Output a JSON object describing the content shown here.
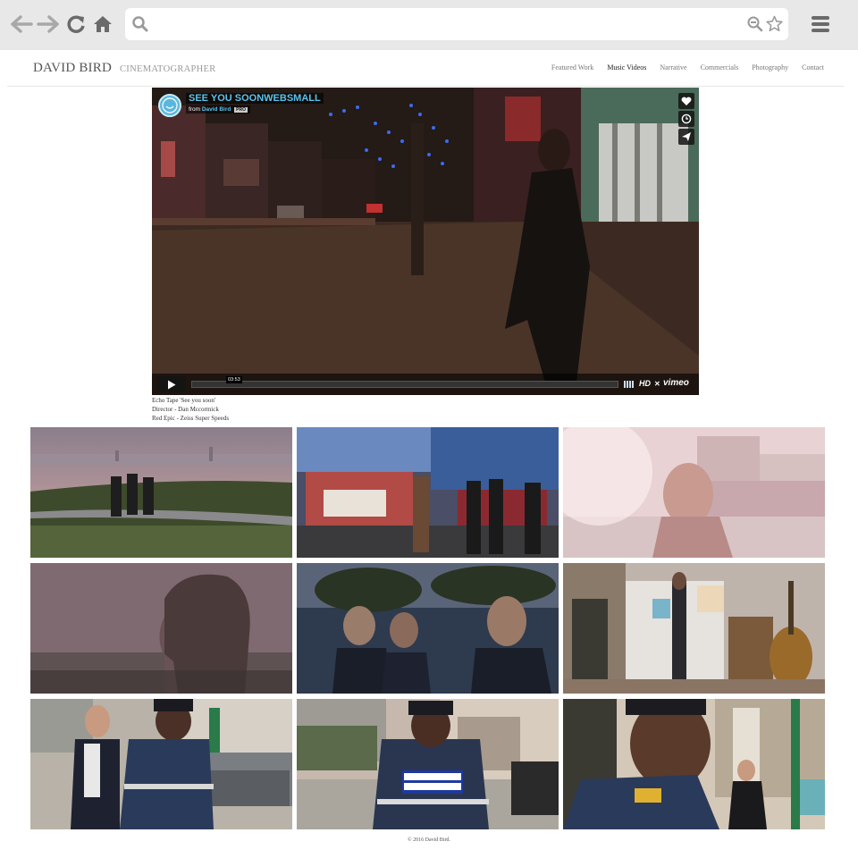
{
  "browser": {
    "url_value": "",
    "icons": [
      "back-arrow-icon",
      "forward-arrow-icon",
      "reload-icon",
      "home-icon",
      "search-icon",
      "zoom-out-icon",
      "star-icon",
      "menu-icon"
    ]
  },
  "site": {
    "brand": "DAVID BIRD",
    "tagline": "CINEMATOGRAPHER",
    "nav": [
      {
        "label": "Featured Work",
        "active": false
      },
      {
        "label": "Music Videos",
        "active": true
      },
      {
        "label": "Narrative",
        "active": false
      },
      {
        "label": "Commercials",
        "active": false
      },
      {
        "label": "Photography",
        "active": false
      },
      {
        "label": "Contact",
        "active": false
      }
    ]
  },
  "video": {
    "title": "SEE YOU SOONWEBSMALL",
    "from_prefix": "from",
    "author": "David Bird",
    "badge": "PRO",
    "time": "03:53",
    "hd_label": "HD",
    "brand_label": "vimeo",
    "accent_color": "#59c3ec"
  },
  "credits": [
    "Echo Tape 'See you soon'",
    "Director - Dan Mccormick",
    "Red Epic - Zeiss Super Speeds"
  ],
  "gallery": [
    {
      "name": "thumb-hilltop-silhouettes"
    },
    {
      "name": "thumb-graffiti-band"
    },
    {
      "name": "thumb-sunflare-portrait"
    },
    {
      "name": "thumb-profile-closeup"
    },
    {
      "name": "thumb-band-night"
    },
    {
      "name": "thumb-guitar-room"
    },
    {
      "name": "thumb-traffic-warden-street"
    },
    {
      "name": "thumb-traffic-warden-back"
    },
    {
      "name": "thumb-warden-woman"
    }
  ],
  "footer": "© 2016 David Bird."
}
